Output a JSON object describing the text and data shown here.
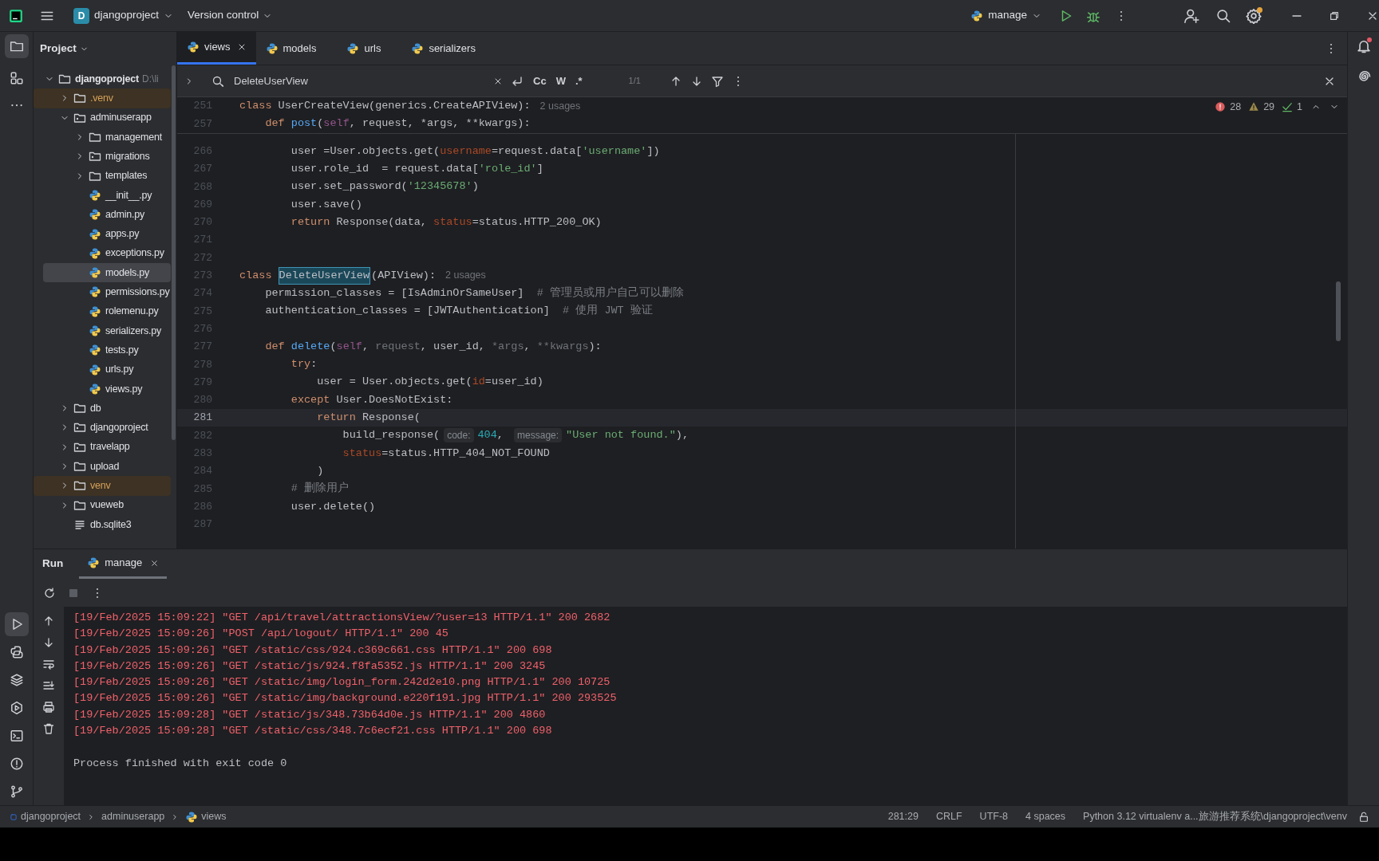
{
  "title_bar": {
    "project_badge": "D",
    "project": "djangoproject",
    "vcs": "Version control",
    "run_config": "manage"
  },
  "project_panel": {
    "title": "Project",
    "tree": [
      {
        "label": "djangoproject",
        "kind": "folder",
        "expanded": true,
        "selected": false,
        "excluded": false,
        "hint": "D:\\li",
        "children": [
          {
            "label": ".venv",
            "kind": "folder",
            "expanded": false,
            "selected": false,
            "excluded": true
          },
          {
            "label": "adminuserapp",
            "kind": "package",
            "expanded": true,
            "selected": false,
            "excluded": false,
            "children": [
              {
                "label": "management",
                "kind": "folder",
                "expanded": false,
                "selected": false,
                "excluded": false
              },
              {
                "label": "migrations",
                "kind": "package",
                "expanded": false,
                "selected": false,
                "excluded": false
              },
              {
                "label": "templates",
                "kind": "folder",
                "expanded": false,
                "selected": false,
                "excluded": false
              },
              {
                "label": "__init__.py",
                "kind": "python",
                "selected": false,
                "excluded": false
              },
              {
                "label": "admin.py",
                "kind": "python",
                "selected": false,
                "excluded": false
              },
              {
                "label": "apps.py",
                "kind": "python",
                "selected": false,
                "excluded": false
              },
              {
                "label": "exceptions.py",
                "kind": "python",
                "selected": false,
                "excluded": false
              },
              {
                "label": "models.py",
                "kind": "python",
                "selected": true,
                "excluded": false
              },
              {
                "label": "permissions.py",
                "kind": "python",
                "selected": false,
                "excluded": false
              },
              {
                "label": "rolemenu.py",
                "kind": "python",
                "selected": false,
                "excluded": false
              },
              {
                "label": "serializers.py",
                "kind": "python",
                "selected": false,
                "excluded": false
              },
              {
                "label": "tests.py",
                "kind": "python",
                "selected": false,
                "excluded": false
              },
              {
                "label": "urls.py",
                "kind": "python",
                "selected": false,
                "excluded": false
              },
              {
                "label": "views.py",
                "kind": "python",
                "selected": false,
                "excluded": false
              }
            ]
          },
          {
            "label": "db",
            "kind": "folder",
            "expanded": false,
            "selected": false,
            "excluded": false
          },
          {
            "label": "djangoproject",
            "kind": "package",
            "expanded": false,
            "selected": false,
            "excluded": false
          },
          {
            "label": "travelapp",
            "kind": "package",
            "expanded": false,
            "selected": false,
            "excluded": false
          },
          {
            "label": "upload",
            "kind": "folder",
            "expanded": false,
            "selected": false,
            "excluded": false
          },
          {
            "label": "venv",
            "kind": "folder",
            "expanded": false,
            "selected": false,
            "excluded": true
          },
          {
            "label": "vueweb",
            "kind": "folder",
            "expanded": false,
            "selected": false,
            "excluded": false
          },
          {
            "label": "db.sqlite3",
            "kind": "text",
            "selected": false,
            "excluded": false
          }
        ]
      }
    ]
  },
  "editor_tabs": [
    {
      "label": "views",
      "selected": true
    },
    {
      "label": "models",
      "selected": false
    },
    {
      "label": "urls",
      "selected": false
    },
    {
      "label": "serializers",
      "selected": false
    }
  ],
  "find_bar": {
    "query": "DeleteUserView",
    "options": [
      "Cc",
      "W",
      ".*"
    ],
    "match_count": "1/1"
  },
  "inspections": {
    "errors": "28",
    "warnings": "29",
    "weak": "1"
  },
  "sticky_lines": [
    {
      "number": "251",
      "tokens": [
        {
          "kind": "kw",
          "text": "class "
        },
        {
          "kind": "plain",
          "text": "UserCreateView(generics.CreateAPIView):"
        },
        {
          "kind": "usage",
          "text": "2 usages"
        }
      ]
    },
    {
      "number": "257",
      "tokens": [
        {
          "kind": "kw",
          "text": "    def "
        },
        {
          "kind": "fn",
          "text": "post"
        },
        {
          "kind": "plain",
          "text": "("
        },
        {
          "kind": "self",
          "text": "self"
        },
        {
          "kind": "plain",
          "text": ", request, *args, **kwargs):"
        }
      ]
    }
  ],
  "code_lines": [
    {
      "number": "266",
      "current": false,
      "tokens": [
        {
          "kind": "plain",
          "text": "        user =User.objects.get("
        },
        {
          "kind": "param",
          "text": "username"
        },
        {
          "kind": "plain",
          "text": "=request.data["
        },
        {
          "kind": "str",
          "text": "'username'"
        },
        {
          "kind": "plain",
          "text": "])"
        }
      ]
    },
    {
      "number": "267",
      "current": false,
      "tokens": [
        {
          "kind": "plain",
          "text": "        user.role_id  = request.data["
        },
        {
          "kind": "str",
          "text": "'role_id'"
        },
        {
          "kind": "plain",
          "text": "]"
        }
      ]
    },
    {
      "number": "268",
      "current": false,
      "tokens": [
        {
          "kind": "plain",
          "text": "        user.set_password("
        },
        {
          "kind": "str",
          "text": "'12345678'"
        },
        {
          "kind": "plain",
          "text": ")"
        }
      ]
    },
    {
      "number": "269",
      "current": false,
      "tokens": [
        {
          "kind": "plain",
          "text": "        user.save()"
        }
      ]
    },
    {
      "number": "270",
      "current": false,
      "tokens": [
        {
          "kind": "kw",
          "text": "        return"
        },
        {
          "kind": "plain",
          "text": " Response(data, "
        },
        {
          "kind": "param",
          "text": "status"
        },
        {
          "kind": "plain",
          "text": "=status.HTTP_200_OK)"
        }
      ]
    },
    {
      "number": "271",
      "current": false
    },
    {
      "number": "272",
      "current": false
    },
    {
      "number": "273",
      "current": false,
      "tokens": [
        {
          "kind": "kw",
          "text": "class "
        },
        {
          "kind": "match",
          "text": "DeleteUserView"
        },
        {
          "kind": "plain",
          "text": "(APIView):"
        },
        {
          "kind": "usage",
          "text": "2 usages"
        }
      ]
    },
    {
      "number": "274",
      "current": false,
      "tokens": [
        {
          "kind": "plain",
          "text": "    permission_classes = [IsAdminOrSameUser]  "
        },
        {
          "kind": "comment",
          "text": "# 管理员或用户自己可以删除"
        }
      ]
    },
    {
      "number": "275",
      "current": false,
      "tokens": [
        {
          "kind": "plain",
          "text": "    authentication_classes = [JWTAuthentication]  "
        },
        {
          "kind": "comment",
          "text": "# 使用 JWT 验证"
        }
      ]
    },
    {
      "number": "276",
      "current": false
    },
    {
      "number": "277",
      "current": false,
      "tokens": [
        {
          "kind": "kw",
          "text": "    def "
        },
        {
          "kind": "fn",
          "text": "delete"
        },
        {
          "kind": "plain",
          "text": "("
        },
        {
          "kind": "self",
          "text": "self"
        },
        {
          "kind": "plain",
          "text": ", "
        },
        {
          "kind": "dim",
          "text": "request"
        },
        {
          "kind": "plain",
          "text": ", user_id, "
        },
        {
          "kind": "dim",
          "text": "*args"
        },
        {
          "kind": "plain",
          "text": ", "
        },
        {
          "kind": "dim",
          "text": "**kwargs"
        },
        {
          "kind": "plain",
          "text": "):"
        }
      ]
    },
    {
      "number": "278",
      "current": false,
      "tokens": [
        {
          "kind": "kw",
          "text": "        try"
        },
        {
          "kind": "plain",
          "text": ":"
        }
      ]
    },
    {
      "number": "279",
      "current": false,
      "tokens": [
        {
          "kind": "plain",
          "text": "            user = User.objects.get("
        },
        {
          "kind": "param",
          "text": "id"
        },
        {
          "kind": "plain",
          "text": "=user_id)"
        }
      ]
    },
    {
      "number": "280",
      "current": false,
      "tokens": [
        {
          "kind": "kw",
          "text": "        except"
        },
        {
          "kind": "plain",
          "text": " User.DoesNotExist:"
        }
      ]
    },
    {
      "number": "281",
      "current": true,
      "tokens": [
        {
          "kind": "kw",
          "text": "            return"
        },
        {
          "kind": "plain",
          "text": " Response("
        }
      ]
    },
    {
      "number": "282",
      "current": false,
      "tokens": [
        {
          "kind": "plain",
          "text": "                build_response("
        },
        {
          "kind": "hint",
          "text": "code:"
        },
        {
          "kind": "num",
          "text": "404"
        },
        {
          "kind": "plain",
          "text": ", "
        },
        {
          "kind": "hint",
          "text": "message:"
        },
        {
          "kind": "str",
          "text": "\"User not found.\""
        },
        {
          "kind": "plain",
          "text": "),"
        }
      ]
    },
    {
      "number": "283",
      "current": false,
      "tokens": [
        {
          "kind": "param",
          "text": "                status"
        },
        {
          "kind": "plain",
          "text": "=status.HTTP_404_NOT_FOUND"
        }
      ]
    },
    {
      "number": "284",
      "current": false,
      "tokens": [
        {
          "kind": "plain",
          "text": "            )"
        }
      ]
    },
    {
      "number": "285",
      "current": false,
      "tokens": [
        {
          "kind": "comment",
          "text": "        # 删除用户"
        }
      ]
    },
    {
      "number": "286",
      "current": false,
      "tokens": [
        {
          "kind": "plain",
          "text": "        user.delete()"
        }
      ]
    },
    {
      "number": "287",
      "current": false
    }
  ],
  "run_panel": {
    "title": "Run",
    "tabs": [
      {
        "label": "manage",
        "selected": true
      }
    ],
    "output": [
      {
        "kind": "error",
        "text": "[19/Feb/2025 15:09:22] \"GET /api/travel/attractionsView/?user=13 HTTP/1.1\" 200 2682"
      },
      {
        "kind": "error",
        "text": "[19/Feb/2025 15:09:26] \"POST /api/logout/ HTTP/1.1\" 200 45"
      },
      {
        "kind": "error",
        "text": "[19/Feb/2025 15:09:26] \"GET /static/css/924.c369c661.css HTTP/1.1\" 200 698"
      },
      {
        "kind": "error",
        "text": "[19/Feb/2025 15:09:26] \"GET /static/js/924.f8fa5352.js HTTP/1.1\" 200 3245"
      },
      {
        "kind": "error",
        "text": "[19/Feb/2025 15:09:26] \"GET /static/img/login_form.242d2e10.png HTTP/1.1\" 200 10725"
      },
      {
        "kind": "error",
        "text": "[19/Feb/2025 15:09:26] \"GET /static/img/background.e220f191.jpg HTTP/1.1\" 200 293525"
      },
      {
        "kind": "error",
        "text": "[19/Feb/2025 15:09:28] \"GET /static/js/348.73b64d0e.js HTTP/1.1\" 200 4860"
      },
      {
        "kind": "error",
        "text": "[19/Feb/2025 15:09:28] \"GET /static/css/348.7c6ecf21.css HTTP/1.1\" 200 698"
      },
      {
        "kind": "blank"
      },
      {
        "kind": "plain",
        "text": "Process finished with exit code 0"
      }
    ]
  },
  "status_bar": {
    "breadcrumbs": [
      {
        "label": "djangoproject",
        "kind": "module"
      },
      {
        "label": "adminuserapp",
        "kind": "folder"
      },
      {
        "label": "views",
        "kind": "python"
      }
    ],
    "items": [
      "281:29",
      "CRLF",
      "UTF-8",
      "4 spaces",
      "Python 3.12 virtualenv a...旅游推荐系统\\djangoproject\\venv"
    ]
  }
}
